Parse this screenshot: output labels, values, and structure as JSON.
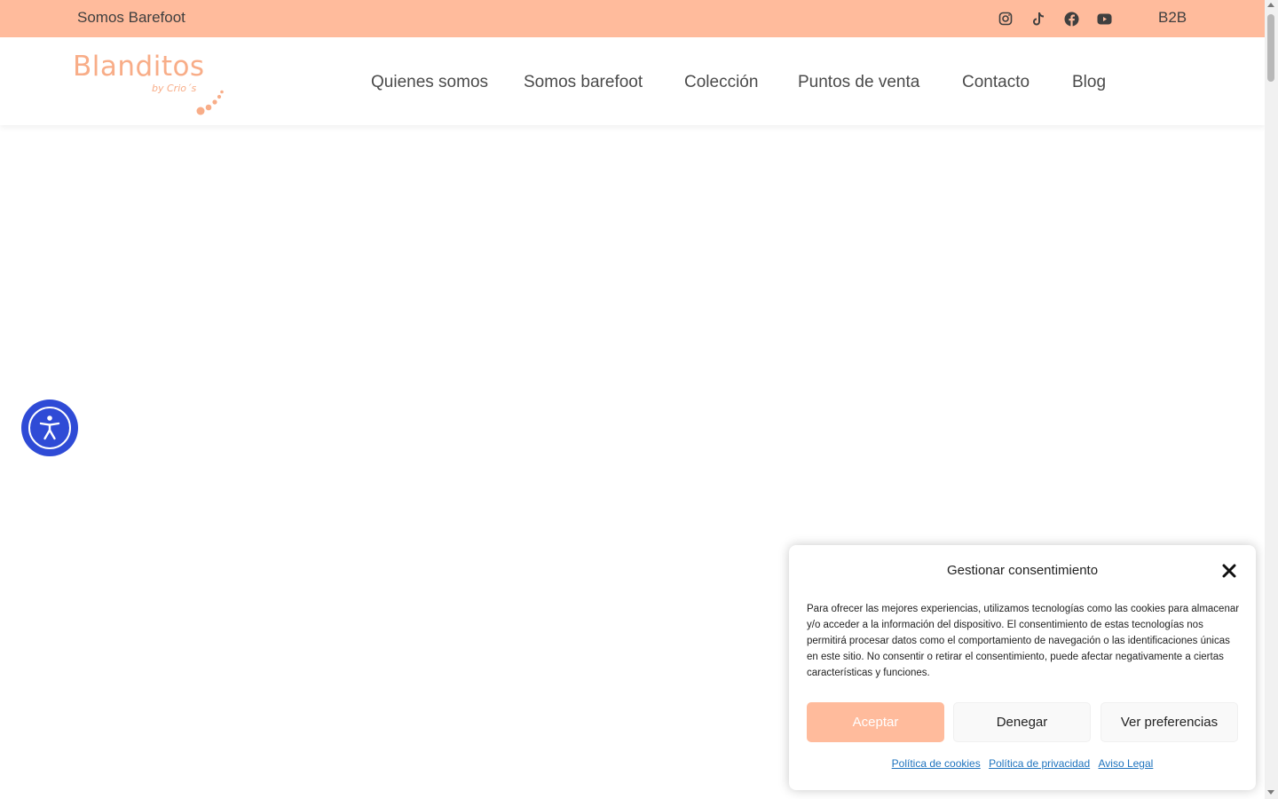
{
  "topbar": {
    "tagline": "Somos Barefoot",
    "social": [
      "instagram-icon",
      "tiktok-icon",
      "facebook-icon",
      "youtube-icon"
    ],
    "b2b_label": "B2B",
    "background": "#ffbb9c"
  },
  "logo": {
    "name": "Blanditos",
    "byline": "by Crio´s",
    "color": "#f8ad88"
  },
  "nav": {
    "items": [
      {
        "label": "Quienes somos"
      },
      {
        "label": "Somos barefoot"
      },
      {
        "label": "Colección"
      },
      {
        "label": "Puntos de venta"
      },
      {
        "label": "Contacto"
      },
      {
        "label": "Blog"
      }
    ]
  },
  "accessibility": {
    "icon": "accessibility-icon",
    "color": "#2f4bd6"
  },
  "consent": {
    "title": "Gestionar consentimiento",
    "body": "Para ofrecer las mejores experiencias, utilizamos tecnologías como las cookies para almacenar y/o acceder a la información del dispositivo. El consentimiento de estas tecnologías nos permitirá procesar datos como el comportamiento de navegación o las identificaciones únicas en este sitio. No consentir o retirar el consentimiento, puede afectar negativamente a ciertas características y funciones.",
    "accept_label": "Aceptar",
    "deny_label": "Denegar",
    "prefs_label": "Ver preferencias",
    "links": {
      "cookies": "Política de cookies",
      "privacy": "Política de privacidad",
      "legal": "Aviso Legal"
    },
    "accent": "#ffbb9c",
    "link_color": "#1e73be"
  }
}
